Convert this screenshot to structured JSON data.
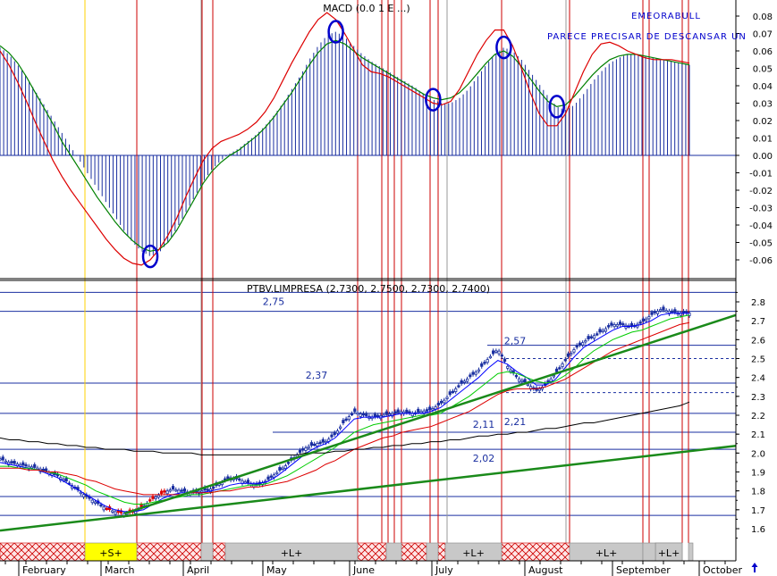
{
  "chart_data": [
    {
      "type": "bar",
      "panel": "macd",
      "title": "MACD (0.0 1 E ...)",
      "annotations": [
        "EMEORABULL",
        "PARECE PRECISAR DE DESCANSAR UN"
      ],
      "ylim": [
        -0.07,
        0.09
      ],
      "yticks": [
        "0.08",
        "0.07",
        "0.06",
        "0.05",
        "0.04",
        "0.03",
        "0.02",
        "0.01",
        "0.00",
        "-0.01",
        "-0.02",
        "-0.03",
        "-0.04",
        "-0.05",
        "-0.06"
      ],
      "histogram": [
        0.062,
        0.058,
        0.052,
        0.045,
        0.037,
        0.029,
        0.021,
        0.013,
        0.005,
        -0.003,
        -0.011,
        -0.019,
        -0.027,
        -0.035,
        -0.043,
        -0.05,
        -0.055,
        -0.058,
        -0.056,
        -0.05,
        -0.042,
        -0.033,
        -0.024,
        -0.015,
        -0.008,
        -0.003,
        0.001,
        0.004,
        0.008,
        0.012,
        0.017,
        0.023,
        0.03,
        0.038,
        0.046,
        0.055,
        0.063,
        0.069,
        0.071,
        0.068,
        0.063,
        0.058,
        0.054,
        0.051,
        0.048,
        0.045,
        0.042,
        0.039,
        0.035,
        0.032,
        0.03,
        0.03,
        0.033,
        0.038,
        0.045,
        0.052,
        0.058,
        0.062,
        0.06,
        0.055,
        0.048,
        0.041,
        0.034,
        0.028,
        0.026,
        0.029,
        0.035,
        0.042,
        0.048,
        0.053,
        0.056,
        0.058,
        0.058,
        0.057,
        0.056,
        0.055,
        0.054,
        0.053,
        0.052
      ],
      "signal_series": [
        {
          "color": "#008000",
          "values": [
            0.063,
            0.059,
            0.053,
            0.045,
            0.036,
            0.027,
            0.018,
            0.008,
            0.0,
            -0.008,
            -0.016,
            -0.024,
            -0.031,
            -0.038,
            -0.044,
            -0.049,
            -0.053,
            -0.055,
            -0.054,
            -0.05,
            -0.043,
            -0.034,
            -0.025,
            -0.016,
            -0.009,
            -0.004,
            0.0,
            0.003,
            0.007,
            0.011,
            0.016,
            0.022,
            0.029,
            0.036,
            0.044,
            0.052,
            0.059,
            0.064,
            0.066,
            0.064,
            0.06,
            0.056,
            0.053,
            0.05,
            0.047,
            0.044,
            0.041,
            0.038,
            0.035,
            0.033,
            0.032,
            0.033,
            0.036,
            0.041,
            0.047,
            0.053,
            0.058,
            0.06,
            0.057,
            0.051,
            0.044,
            0.037,
            0.031,
            0.028,
            0.029,
            0.034,
            0.04,
            0.046,
            0.051,
            0.055,
            0.057,
            0.058,
            0.058,
            0.057,
            0.056,
            0.055,
            0.054,
            0.053,
            0.052
          ]
        },
        {
          "color": "#dd0000",
          "values": [
            0.06,
            0.052,
            0.042,
            0.031,
            0.019,
            0.008,
            -0.003,
            -0.012,
            -0.02,
            -0.027,
            -0.034,
            -0.041,
            -0.048,
            -0.054,
            -0.059,
            -0.062,
            -0.063,
            -0.06,
            -0.054,
            -0.046,
            -0.036,
            -0.024,
            -0.013,
            -0.003,
            0.004,
            0.008,
            0.01,
            0.012,
            0.015,
            0.019,
            0.025,
            0.033,
            0.043,
            0.053,
            0.062,
            0.071,
            0.078,
            0.082,
            0.078,
            0.07,
            0.061,
            0.052,
            0.048,
            0.047,
            0.045,
            0.042,
            0.039,
            0.036,
            0.033,
            0.03,
            0.029,
            0.031,
            0.038,
            0.048,
            0.058,
            0.066,
            0.072,
            0.072,
            0.063,
            0.05,
            0.036,
            0.024,
            0.017,
            0.017,
            0.024,
            0.036,
            0.048,
            0.058,
            0.064,
            0.065,
            0.063,
            0.06,
            0.058,
            0.056,
            0.055,
            0.055,
            0.055,
            0.054,
            0.053
          ]
        }
      ],
      "markers": [
        {
          "x_index": 17
        },
        {
          "x_index": 38
        },
        {
          "x_index": 49
        },
        {
          "x_index": 57
        },
        {
          "x_index": 63
        }
      ]
    },
    {
      "type": "line",
      "panel": "price",
      "title": "PTBV.LIMPRESA (2.7300, 2.7500, 2.7300, 2.7400)",
      "ylim": [
        1.53,
        2.87
      ],
      "yticks": [
        "2.8",
        "2.7",
        "2.6",
        "2.5",
        "2.4",
        "2.3",
        "2.2",
        "2.1",
        "2.0",
        "1.9",
        "1.8",
        "1.7",
        "1.6"
      ],
      "x_labels": [
        "February",
        "March",
        "April",
        "May",
        "June",
        "July",
        "August",
        "September",
        "October"
      ],
      "levels": [
        {
          "value": 2.75,
          "label": "2,75"
        },
        {
          "value": 2.57,
          "label": "2,57"
        },
        {
          "value": 2.37,
          "label": "2,37"
        },
        {
          "value": 2.21,
          "label": "2,21"
        },
        {
          "value": 2.11,
          "label": "2,11"
        },
        {
          "value": 2.02,
          "label": "2,02"
        }
      ],
      "price": [
        1.97,
        1.95,
        1.94,
        1.93,
        1.92,
        1.9,
        1.88,
        1.85,
        1.81,
        1.77,
        1.74,
        1.71,
        1.69,
        1.68,
        1.69,
        1.72,
        1.76,
        1.79,
        1.81,
        1.8,
        1.79,
        1.8,
        1.81,
        1.84,
        1.87,
        1.86,
        1.84,
        1.83,
        1.86,
        1.9,
        1.94,
        1.99,
        2.03,
        2.05,
        2.06,
        2.1,
        2.17,
        2.22,
        2.2,
        2.19,
        2.2,
        2.21,
        2.22,
        2.21,
        2.22,
        2.23,
        2.26,
        2.31,
        2.36,
        2.4,
        2.44,
        2.5,
        2.55,
        2.46,
        2.4,
        2.37,
        2.33,
        2.36,
        2.42,
        2.49,
        2.55,
        2.59,
        2.62,
        2.65,
        2.68,
        2.68,
        2.67,
        2.69,
        2.73,
        2.76,
        2.75,
        2.74,
        2.74
      ],
      "ma_series": [
        {
          "color": "#0000ff",
          "values": [
            1.95,
            1.94,
            1.93,
            1.92,
            1.91,
            1.89,
            1.87,
            1.84,
            1.81,
            1.78,
            1.75,
            1.72,
            1.7,
            1.69,
            1.69,
            1.7,
            1.73,
            1.76,
            1.78,
            1.79,
            1.79,
            1.79,
            1.8,
            1.81,
            1.83,
            1.84,
            1.84,
            1.84,
            1.85,
            1.88,
            1.92,
            1.96,
            2.0,
            2.03,
            2.05,
            2.08,
            2.13,
            2.18,
            2.19,
            2.19,
            2.19,
            2.2,
            2.21,
            2.21,
            2.21,
            2.22,
            2.24,
            2.28,
            2.32,
            2.36,
            2.4,
            2.45,
            2.49,
            2.47,
            2.43,
            2.4,
            2.36,
            2.36,
            2.39,
            2.45,
            2.51,
            2.56,
            2.59,
            2.62,
            2.65,
            2.67,
            2.67,
            2.68,
            2.7,
            2.73,
            2.74,
            2.74,
            2.74
          ]
        },
        {
          "color": "#00cc00",
          "values": [
            1.93,
            1.93,
            1.92,
            1.92,
            1.91,
            1.9,
            1.89,
            1.87,
            1.85,
            1.83,
            1.8,
            1.78,
            1.76,
            1.74,
            1.73,
            1.73,
            1.74,
            1.75,
            1.76,
            1.77,
            1.78,
            1.78,
            1.79,
            1.8,
            1.81,
            1.82,
            1.83,
            1.83,
            1.84,
            1.86,
            1.88,
            1.91,
            1.94,
            1.97,
            2.0,
            2.03,
            2.07,
            2.11,
            2.13,
            2.15,
            2.16,
            2.17,
            2.18,
            2.19,
            2.2,
            2.2,
            2.21,
            2.24,
            2.27,
            2.3,
            2.34,
            2.38,
            2.42,
            2.43,
            2.42,
            2.4,
            2.38,
            2.37,
            2.38,
            2.41,
            2.45,
            2.5,
            2.54,
            2.57,
            2.6,
            2.62,
            2.64,
            2.65,
            2.67,
            2.69,
            2.71,
            2.72,
            2.73
          ]
        },
        {
          "color": "#dd0000",
          "values": [
            1.92,
            1.92,
            1.92,
            1.91,
            1.91,
            1.9,
            1.9,
            1.89,
            1.88,
            1.86,
            1.85,
            1.83,
            1.81,
            1.8,
            1.79,
            1.78,
            1.78,
            1.78,
            1.78,
            1.78,
            1.79,
            1.79,
            1.79,
            1.8,
            1.8,
            1.81,
            1.82,
            1.82,
            1.83,
            1.84,
            1.85,
            1.87,
            1.89,
            1.91,
            1.94,
            1.96,
            1.99,
            2.02,
            2.04,
            2.06,
            2.08,
            2.09,
            2.11,
            2.12,
            2.13,
            2.14,
            2.16,
            2.18,
            2.2,
            2.22,
            2.25,
            2.28,
            2.31,
            2.33,
            2.34,
            2.34,
            2.34,
            2.35,
            2.37,
            2.39,
            2.42,
            2.45,
            2.48,
            2.51,
            2.54,
            2.56,
            2.58,
            2.6,
            2.62,
            2.64,
            2.66,
            2.68,
            2.69
          ]
        },
        {
          "color": "#000000",
          "values": [
            2.08,
            2.07,
            2.07,
            2.06,
            2.06,
            2.05,
            2.05,
            2.04,
            2.04,
            2.03,
            2.03,
            2.02,
            2.02,
            2.02,
            2.01,
            2.01,
            2.01,
            2.0,
            2.0,
            2.0,
            2.0,
            1.99,
            1.99,
            1.99,
            1.99,
            1.99,
            1.99,
            1.99,
            1.99,
            1.99,
            1.99,
            1.99,
            2.0,
            2.0,
            2.0,
            2.01,
            2.01,
            2.02,
            2.02,
            2.03,
            2.03,
            2.04,
            2.04,
            2.05,
            2.05,
            2.06,
            2.06,
            2.07,
            2.07,
            2.08,
            2.09,
            2.09,
            2.1,
            2.1,
            2.11,
            2.11,
            2.12,
            2.13,
            2.13,
            2.14,
            2.15,
            2.16,
            2.16,
            2.17,
            2.18,
            2.19,
            2.2,
            2.21,
            2.22,
            2.23,
            2.24,
            2.25,
            2.27
          ]
        }
      ],
      "trendlines": [
        {
          "color": "#1a8a1a",
          "from": [
            0,
            1.59
          ],
          "to": [
            72,
            2.01
          ]
        },
        {
          "color": "#1a8a1a",
          "from": [
            13,
            1.68
          ],
          "to": [
            72,
            2.65
          ]
        }
      ],
      "bands": [
        {
          "label": "+S+",
          "color": "#ffff00"
        },
        {
          "label": "+L+",
          "color": "#c8c8c8"
        },
        {
          "label": "+L+",
          "color": "#c8c8c8"
        },
        {
          "label": "+L+",
          "color": "#c8c8c8"
        },
        {
          "label": "+L+",
          "color": "#c8c8c8"
        }
      ]
    }
  ],
  "corner_icon": "up-arrow-icon"
}
